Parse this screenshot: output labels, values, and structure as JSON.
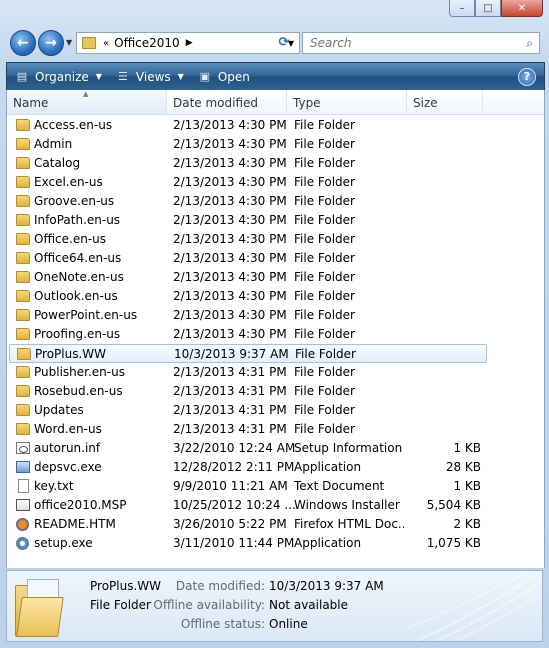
{
  "window": {
    "minimize": "–",
    "maximize": "□",
    "close": "✕"
  },
  "navigation": {
    "back_icon": "back-arrow-icon",
    "forward_icon": "forward-arrow-icon",
    "breadcrumb_prefix": "«",
    "breadcrumb_current": "Office2010",
    "search_placeholder": "Search"
  },
  "toolbar": {
    "organize_label": "Organize",
    "views_label": "Views",
    "open_label": "Open"
  },
  "columns": {
    "name": "Name",
    "date_modified": "Date modified",
    "type": "Type",
    "size": "Size"
  },
  "files": [
    {
      "name": "Access.en-us",
      "date": "2/13/2013 4:30 PM",
      "type": "File Folder",
      "size": "",
      "icon": "folder"
    },
    {
      "name": "Admin",
      "date": "2/13/2013 4:30 PM",
      "type": "File Folder",
      "size": "",
      "icon": "folder"
    },
    {
      "name": "Catalog",
      "date": "2/13/2013 4:30 PM",
      "type": "File Folder",
      "size": "",
      "icon": "folder"
    },
    {
      "name": "Excel.en-us",
      "date": "2/13/2013 4:30 PM",
      "type": "File Folder",
      "size": "",
      "icon": "folder"
    },
    {
      "name": "Groove.en-us",
      "date": "2/13/2013 4:30 PM",
      "type": "File Folder",
      "size": "",
      "icon": "folder"
    },
    {
      "name": "InfoPath.en-us",
      "date": "2/13/2013 4:30 PM",
      "type": "File Folder",
      "size": "",
      "icon": "folder"
    },
    {
      "name": "Office.en-us",
      "date": "2/13/2013 4:30 PM",
      "type": "File Folder",
      "size": "",
      "icon": "folder"
    },
    {
      "name": "Office64.en-us",
      "date": "2/13/2013 4:30 PM",
      "type": "File Folder",
      "size": "",
      "icon": "folder"
    },
    {
      "name": "OneNote.en-us",
      "date": "2/13/2013 4:30 PM",
      "type": "File Folder",
      "size": "",
      "icon": "folder"
    },
    {
      "name": "Outlook.en-us",
      "date": "2/13/2013 4:30 PM",
      "type": "File Folder",
      "size": "",
      "icon": "folder"
    },
    {
      "name": "PowerPoint.en-us",
      "date": "2/13/2013 4:30 PM",
      "type": "File Folder",
      "size": "",
      "icon": "folder"
    },
    {
      "name": "Proofing.en-us",
      "date": "2/13/2013 4:30 PM",
      "type": "File Folder",
      "size": "",
      "icon": "folder"
    },
    {
      "name": "ProPlus.WW",
      "date": "10/3/2013 9:37 AM",
      "type": "File Folder",
      "size": "",
      "icon": "folder",
      "selected": true
    },
    {
      "name": "Publisher.en-us",
      "date": "2/13/2013 4:31 PM",
      "type": "File Folder",
      "size": "",
      "icon": "folder"
    },
    {
      "name": "Rosebud.en-us",
      "date": "2/13/2013 4:31 PM",
      "type": "File Folder",
      "size": "",
      "icon": "folder"
    },
    {
      "name": "Updates",
      "date": "2/13/2013 4:31 PM",
      "type": "File Folder",
      "size": "",
      "icon": "folder"
    },
    {
      "name": "Word.en-us",
      "date": "2/13/2013 4:31 PM",
      "type": "File Folder",
      "size": "",
      "icon": "folder"
    },
    {
      "name": "autorun.inf",
      "date": "3/22/2010 12:24 AM",
      "type": "Setup Information",
      "size": "1 KB",
      "icon": "inf"
    },
    {
      "name": "depsvc.exe",
      "date": "12/28/2012 2:11 PM",
      "type": "Application",
      "size": "28 KB",
      "icon": "exe"
    },
    {
      "name": "key.txt",
      "date": "9/9/2010 11:21 AM",
      "type": "Text Document",
      "size": "1 KB",
      "icon": "file"
    },
    {
      "name": "office2010.MSP",
      "date": "10/25/2012 10:24 ...",
      "type": "Windows Installer ...",
      "size": "5,504 KB",
      "icon": "msi"
    },
    {
      "name": "README.HTM",
      "date": "3/26/2010 5:22 PM",
      "type": "Firefox HTML Doc...",
      "size": "2 KB",
      "icon": "htm"
    },
    {
      "name": "setup.exe",
      "date": "3/11/2010 11:44 PM",
      "type": "Application",
      "size": "1,075 KB",
      "icon": "setup"
    }
  ],
  "details": {
    "name": "ProPlus.WW",
    "type": "File Folder",
    "date_modified_label": "Date modified:",
    "date_modified_value": "10/3/2013 9:37 AM",
    "offline_availability_label": "Offline availability:",
    "offline_availability_value": "Not available",
    "offline_status_label": "Offline status:",
    "offline_status_value": "Online"
  }
}
